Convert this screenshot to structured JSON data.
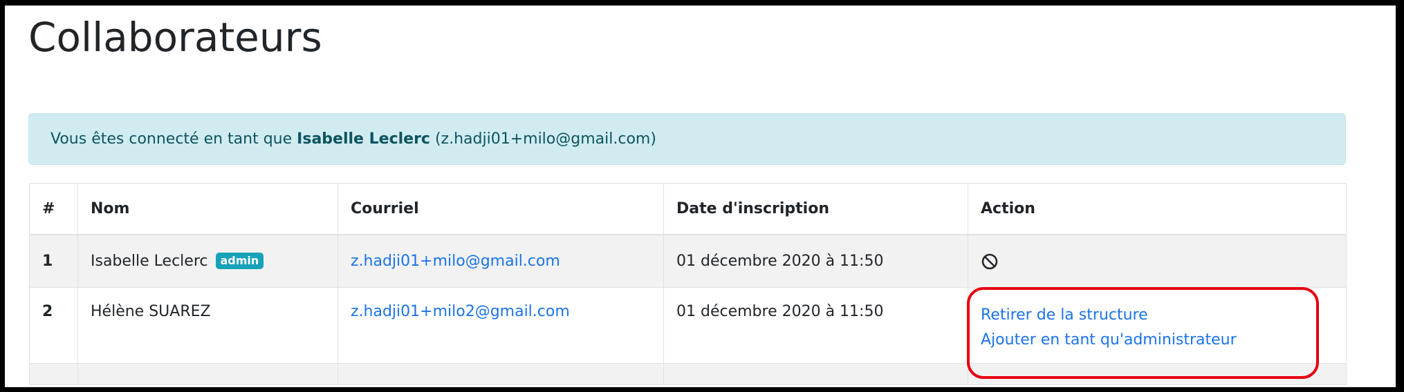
{
  "page": {
    "title": "Collaborateurs"
  },
  "alert": {
    "prefix": "Vous êtes connecté en tant que",
    "user_name": "Isabelle Leclerc",
    "user_email": "(z.hadji01+milo@gmail.com)"
  },
  "table": {
    "headers": [
      "#",
      "Nom",
      "Courriel",
      "Date d'inscription",
      "Action"
    ],
    "rows": [
      {
        "num": "1",
        "name": "Isabelle Leclerc",
        "badge": "admin",
        "email": "z.hadji01+milo@gmail.com",
        "date": "01 décembre 2020 à 11:50",
        "action_icon": "ban-icon"
      },
      {
        "num": "2",
        "name": "Hélène SUAREZ",
        "email": "z.hadji01+milo2@gmail.com",
        "date": "01 décembre 2020 à 11:50",
        "actions": [
          "Retirer de la structure",
          "Ajouter en tant qu'administrateur"
        ]
      }
    ]
  },
  "colors": {
    "link": "#1a73e8",
    "alert_bg": "#d1ecf1",
    "alert_text": "#0c5460",
    "badge_bg": "#17a2b8",
    "highlight": "#e60012",
    "row_stripe": "#f2f2f2"
  }
}
